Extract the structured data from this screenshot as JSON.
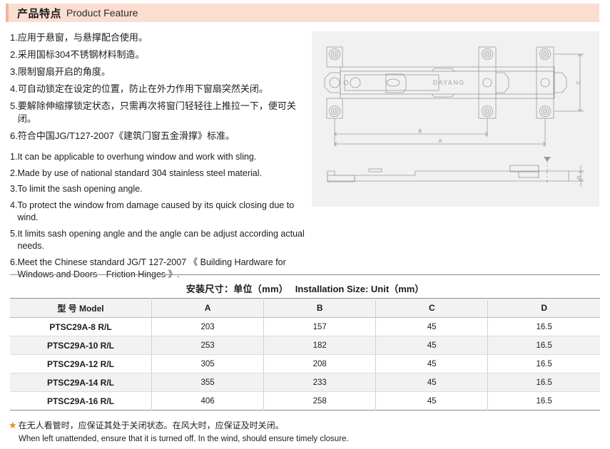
{
  "header": {
    "title_cn": "产品特点",
    "title_en": "Product Feature",
    "bar_color": "#fbded0",
    "accent_color": "#f0b79a"
  },
  "features_cn": [
    {
      "num": "1.",
      "text": "应用于悬窗，与悬撑配合使用。"
    },
    {
      "num": "2.",
      "text": "采用国标304不锈钢材料制造。"
    },
    {
      "num": "3.",
      "text": "限制窗扇开启的角度。"
    },
    {
      "num": "4.",
      "text": "可自动锁定在设定的位置，防止在外力作用下窗扇突然关闭。"
    },
    {
      "num": "5.",
      "text": "要解除伸缩撑锁定状态，只需再次将窗门轻轻往上推拉一下，便可关闭。"
    },
    {
      "num": "6.",
      "text": "符合中国JG/T127-2007《建筑门窗五金滑撑》标准。"
    }
  ],
  "features_en": [
    {
      "num": "1.",
      "text": "It can be applicable to overhung window and work with sling."
    },
    {
      "num": "2.",
      "text": "Made by use of national standard 304 stainless steel material."
    },
    {
      "num": "3.",
      "text": "To limit the sash opening angle."
    },
    {
      "num": "4.",
      "text": "To protect the window from damage caused by its quick closing due to wind."
    },
    {
      "num": "5.",
      "text": "It limits sash opening angle and the angle can be adjust according actual needs."
    },
    {
      "num": "6.",
      "text": "Meet the Chinese standard JG/T 127-2007 《 Building Hardware for Windows and Doors—Friction Hinges 》."
    }
  ],
  "drawing": {
    "background_color": "#f1f1f1",
    "line_color": "#9a9a9a",
    "brand_mark": "DAYANG",
    "dimension_labels": {
      "a": "A",
      "b": "B",
      "c": "C",
      "d": "D"
    }
  },
  "table": {
    "title_cn": "安装尺寸：单位（mm）",
    "title_en": "Installation Size: Unit（mm）",
    "columns": [
      "型 号 Model",
      "A",
      "B",
      "C",
      "D"
    ],
    "rows": [
      {
        "model": "PTSC29A-8 R/L",
        "a": "203",
        "b": "157",
        "c": "45",
        "d": "16.5"
      },
      {
        "model": "PTSC29A-10 R/L",
        "a": "253",
        "b": "182",
        "c": "45",
        "d": "16.5"
      },
      {
        "model": "PTSC29A-12 R/L",
        "a": "305",
        "b": "208",
        "c": "45",
        "d": "16.5"
      },
      {
        "model": "PTSC29A-14 R/L",
        "a": "355",
        "b": "233",
        "c": "45",
        "d": "16.5"
      },
      {
        "model": "PTSC29A-16 R/L",
        "a": "406",
        "b": "258",
        "c": "45",
        "d": "16.5"
      }
    ]
  },
  "footnote": {
    "star": "★",
    "star_color": "#f08a1e",
    "text_cn": "在无人看管时，应保证其处于关闭状态。在风大时，应保证及时关闭。",
    "text_en": "When left unattended, ensure that it is turned off. In the wind, should ensure timely closure."
  }
}
